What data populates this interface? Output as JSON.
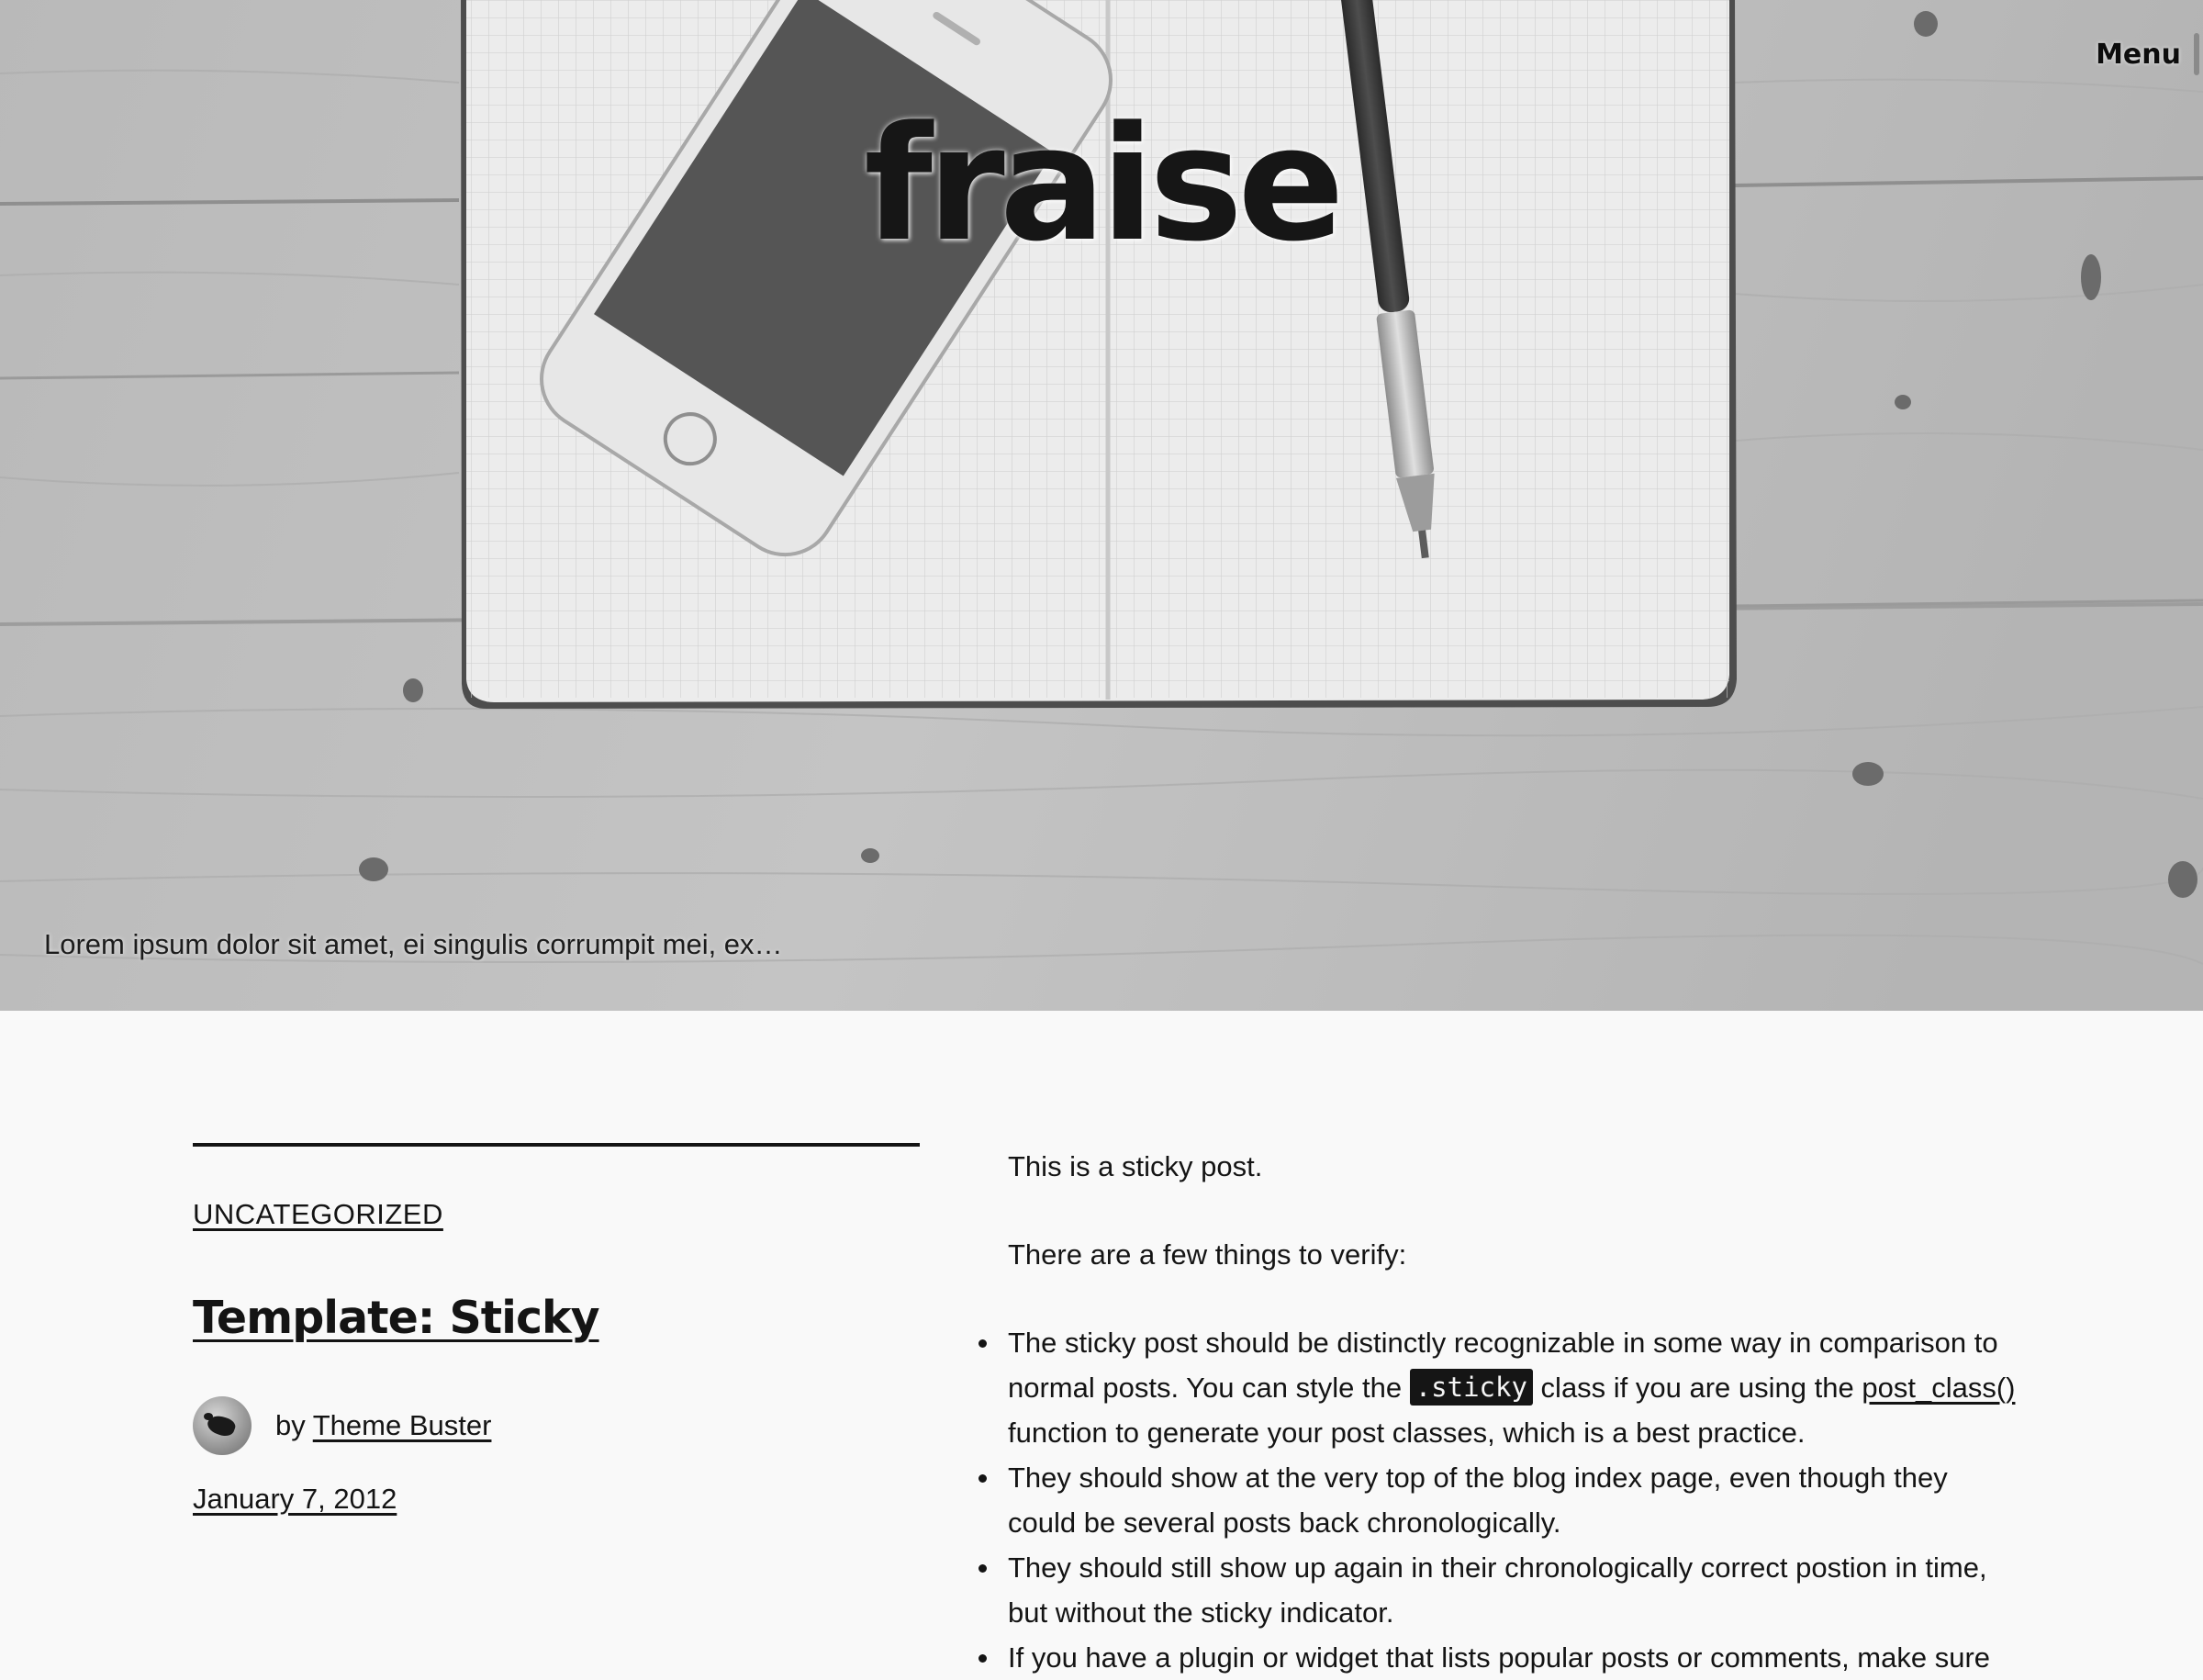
{
  "site": {
    "title": "fraise",
    "tagline": "Lorem ipsum dolor sit amet, ei singulis corrumpit mei, ex…",
    "menu_label": "Menu"
  },
  "post": {
    "category": "UNCATEGORIZED",
    "title": "Template: Sticky",
    "byline_prefix": "by",
    "author": "Theme Buster",
    "date": "January 7, 2012",
    "content": {
      "intro": "This is a sticky post.",
      "lead": "There are a few things to verify:",
      "item1_a": "The sticky post should be distinctly recognizable in some way in comparison to normal posts. You can style the ",
      "item1_code": ".sticky",
      "item1_b": " class if you are using the ",
      "item1_link": "post_class()",
      "item1_c": " function to generate your post classes, which is a best practice.",
      "item2": "They should show at the very top of the blog index page, even though they could be several posts back chronologically.",
      "item3": "They should still show up again in their chronologically correct postion in time, but without the sticky indicator.",
      "item4": "If you have a plugin or widget that lists popular posts or comments, make sure"
    }
  },
  "colors": {
    "page_bg": "#f9f9f9",
    "text": "#141414",
    "code_bg": "#151515"
  }
}
